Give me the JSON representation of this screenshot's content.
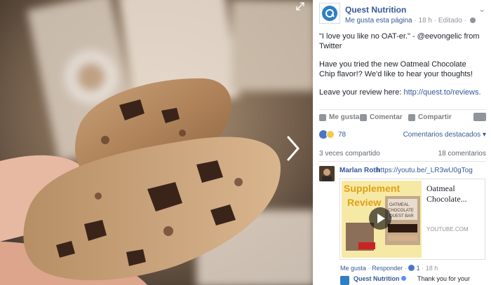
{
  "page": {
    "name": "Quest Nutrition",
    "like_page_label": "Me gusta esta página",
    "time": "18 h",
    "edited": "Editado"
  },
  "post": {
    "line1": "\"I love you like no OAT-er.\" - @eevongelic from Twitter",
    "line2": "Have you tried the new Oatmeal Chocolate Chip flavor!? We'd like to hear your thoughts!",
    "line3_prefix": "Leave your review here: ",
    "line3_link": "http://quest.to/reviews."
  },
  "actions": {
    "like": "Me gusta",
    "comment": "Comentar",
    "share": "Compartir"
  },
  "reactions": {
    "count": "78",
    "filter": "Comentarios destacados"
  },
  "stats": {
    "shares": "3 veces compartido",
    "comments": "18 comentarios"
  },
  "comment": {
    "author": "Marlan Roth",
    "link": "https://youtu.be/_LR3wU0gTog",
    "preview_title": "Oatmeal Chocolate...",
    "preview_domain": "YOUTUBE.COM",
    "like_label": "Me gusta",
    "reply_label": "Responder",
    "like_count": "1",
    "time": "18 h"
  },
  "reply": {
    "author": "Quest Nutrition",
    "text": "Thank you for your"
  },
  "thumb_text": {
    "word1": "Supplement",
    "word2": "Review",
    "box1": "OATMEAL",
    "box2": "CHOCOLATE",
    "box3": "QUEST BAR"
  },
  "colors": {
    "brand": "#2f7fc1",
    "link": "#365899",
    "meta": "#90949c"
  },
  "icons": [
    "expand-icon",
    "next-arrow-icon",
    "globe-icon",
    "options-icon",
    "like-icon",
    "comment-icon",
    "share-icon",
    "play-icon"
  ]
}
